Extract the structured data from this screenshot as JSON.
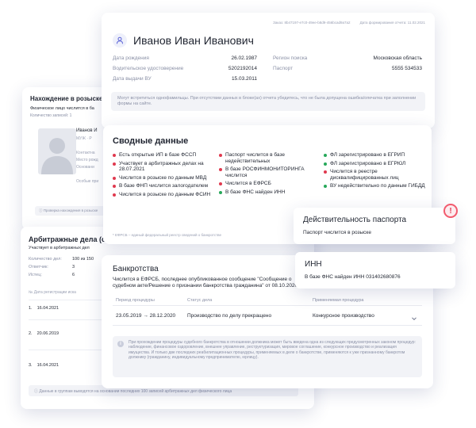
{
  "colors": {
    "red": "#e0394e",
    "green": "#26a85a",
    "blue": "#5b63d6"
  },
  "search_card": {
    "title": "Нахождение в розыске",
    "subtitle": "Физическое лицо числится в ба",
    "count": "Количество записей: 1",
    "name": "Иванов И",
    "rows": [
      "МУЖ  ·  Р",
      "",
      "Контактна",
      "Место рожд",
      "Основани",
      "",
      "Особые при"
    ],
    "footer": "Проверка нахождения в розыске"
  },
  "arb_card": {
    "title": "Арбитражные дела (сп",
    "subtitle": "Участвует в арбитражных дел",
    "stats": [
      {
        "label": "Количество дел:",
        "value": "100 из 150"
      },
      {
        "label": "Ответчик:",
        "value": "3"
      },
      {
        "label": "Истец:",
        "value": "6"
      }
    ],
    "col_header": "№   Дата регистрации иска",
    "cases": [
      {
        "num": "1.",
        "date": "16.04.2021"
      },
      {
        "num": "2.",
        "date": "20.06.2019"
      },
      {
        "num": "3.",
        "date": "16.04.2021"
      }
    ],
    "footer": "Данные в группам выводятся на основании последних 100 записей арбитражных дел физического лица"
  },
  "main_card": {
    "order": "Заказ: 8b47197-e7c0-49ee-b8d9-456bcad9a7a2",
    "report_date": "Дата формирования отчета: 11.02.2021",
    "full_name": "Иванов Иван Иванович",
    "fields": [
      {
        "label": "Дата рождения",
        "value": "26.02.1987"
      },
      {
        "label": "Водительское удостоверение",
        "value": "5202192014"
      },
      {
        "label": "Дата выдачи ВУ",
        "value": "15.03.2011"
      },
      {
        "label": "Регион поиска",
        "value": "Московская область"
      },
      {
        "label": "Паспорт",
        "value": "5555 534533"
      }
    ],
    "note": "Могут встретиться однофамильцы. При отсутствии данных в блоке(ах) отчета убедитесь, что не была допущена ошибка/опечатка при заполнении формы на сайте."
  },
  "summary": {
    "title": "Сводные данные",
    "columns": [
      [
        {
          "text": "Есть открытые ИП в базе ФССП",
          "color": "red"
        },
        {
          "text": "Участвует в арбитражных делах на 28.07.2021",
          "color": "red"
        },
        {
          "text": "Числится в розыске по данным МВД",
          "color": "red"
        },
        {
          "text": "В базе ФНП числится залогодателем",
          "color": "red"
        },
        {
          "text": "Числится в розыске по данным ФСИН",
          "color": "red"
        }
      ],
      [
        {
          "text": "Паспорт числится в базе недействительных",
          "color": "red"
        },
        {
          "text": "В базе РОСФИНМОНИТОРИНГА числится",
          "color": "red"
        },
        {
          "text": "Числится в ЕФРСБ",
          "color": "red"
        },
        {
          "text": "В базе ФНС найден ИНН",
          "color": "green"
        }
      ],
      [
        {
          "text": "ФЛ зарегистрировано в ЕГРИП",
          "color": "green"
        },
        {
          "text": "ФЛ зарегистрировано в ЕГРЮЛ",
          "color": "green"
        },
        {
          "text": "Числится в реестре дисквалифицированных лиц",
          "color": "red"
        },
        {
          "text": "ВУ недействительно по данным ГИБДД",
          "color": "green"
        }
      ]
    ],
    "footnote": "* ЕФРСБ – единый федеральный реестр сведений о банкротстве"
  },
  "bankruptcy": {
    "title": "Банкротства",
    "subtitle": "Числится в ЕФРСБ, последнее опубликованное сообщение \"Сообщение о судебном акте/Решение о признании банкротства гражданина\" от 08.10.2020",
    "headers": [
      "Период процедуры",
      "Статус дела",
      "Применяемая процедура"
    ],
    "row": {
      "period": "23.05.2019 → 28.12.2020",
      "status": "Производство по делу прекращено",
      "procedure": "Конкурсное производство"
    },
    "note": "При прохождении процедуры судебного банкротства в отношении должника может быть введена одна из следующих предусмотренных законом процедур: наблюдение, финансовое оздоровление, внешнее управление, реструктуризация, мировое соглашение, конкурсное производство и реализация имущества. И только две последних реабилитационных процедуры, применяемых в деле о банкротстве, применяются к уже признанному банкротом должнику (гражданину, индивидуальному предпринимателю, юрлицу)."
  },
  "passport_popup": {
    "title": "Действительность паспорта",
    "text": "Паспорт числится в розыске"
  },
  "inn_popup": {
    "title": "ИНН",
    "text": "В базе ФНС найден ИНН 031402680876"
  },
  "alert_badge": "!"
}
